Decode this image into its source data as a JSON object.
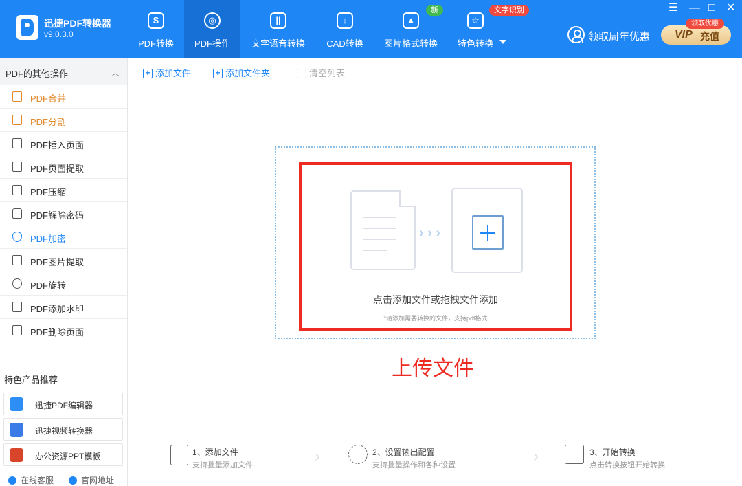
{
  "app": {
    "name": "迅捷PDF转换器",
    "version": "v9.0.3.0"
  },
  "nav": {
    "tabs": [
      {
        "label": "PDF转换",
        "icon": "S"
      },
      {
        "label": "PDF操作",
        "icon": "◎"
      },
      {
        "label": "文字语音转换",
        "icon": "||"
      },
      {
        "label": "CAD转换",
        "icon": "↓"
      },
      {
        "label": "图片格式转换",
        "icon": "▲"
      },
      {
        "label": "特色转换",
        "icon": "☆"
      }
    ],
    "badge_new": "新",
    "badge_ocr": "文字识别"
  },
  "header": {
    "anniversary": "领取周年优惠",
    "vip_label": "VIP",
    "recharge": "充值",
    "vip_badge": "领取优惠"
  },
  "window_controls": {
    "menu": "☰",
    "minimize": "—",
    "maximize": "□",
    "close": "✕"
  },
  "sidebar": {
    "section_title": "PDF的其他操作",
    "collapse_arrow": "︿",
    "items": [
      {
        "label": "PDF合并"
      },
      {
        "label": "PDF分割"
      },
      {
        "label": "PDF插入页面"
      },
      {
        "label": "PDF页面提取"
      },
      {
        "label": "PDF压缩"
      },
      {
        "label": "PDF解除密码"
      },
      {
        "label": "PDF加密"
      },
      {
        "label": "PDF图片提取"
      },
      {
        "label": "PDF旋转"
      },
      {
        "label": "PDF添加水印"
      },
      {
        "label": "PDF删除页面"
      }
    ],
    "recommend_title": "特色产品推荐",
    "recommend": [
      {
        "label": "迅捷PDF编辑器"
      },
      {
        "label": "迅捷视频转换器"
      },
      {
        "label": "办公资源PPT模板"
      }
    ],
    "footer": {
      "online_service": "在线客服",
      "website": "官网地址"
    }
  },
  "toolbar": {
    "add_file": "添加文件",
    "add_folder": "添加文件夹",
    "clear_list": "清空列表"
  },
  "dropzone": {
    "main_text": "点击添加文件或拖拽文件添加",
    "sub_text": "*请添加需要转换的文件，支持pdf格式",
    "chevrons": "› › ›",
    "upload_label": "上传文件"
  },
  "steps": [
    {
      "title": "1、添加文件",
      "desc": "支持批量添加文件"
    },
    {
      "title": "2、设置输出配置",
      "desc": "支持批量操作和各种设置"
    },
    {
      "title": "3、开始转换",
      "desc": "点击转换按钮开始转换"
    }
  ],
  "colors": {
    "primary": "#1f86f6",
    "accent_orange": "#e08a2c",
    "highlight_red": "#ee2b22"
  }
}
